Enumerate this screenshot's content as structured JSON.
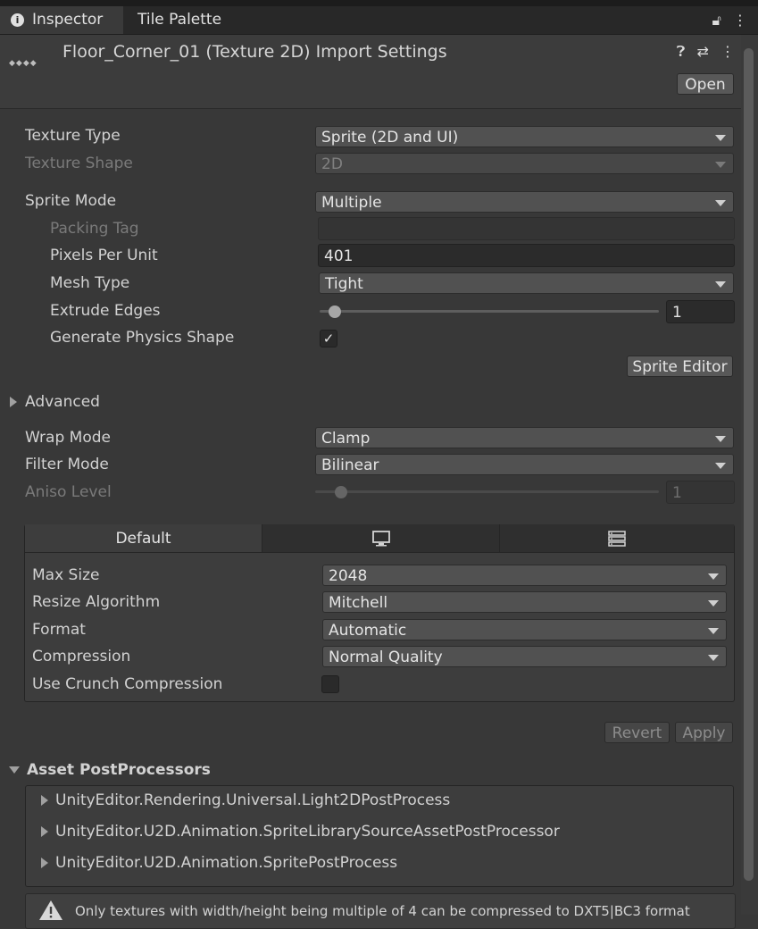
{
  "tabs": [
    {
      "label": "Inspector",
      "icon": "info-icon"
    },
    {
      "label": "Tile Palette"
    }
  ],
  "header": {
    "title": "Floor_Corner_01 (Texture 2D) Import Settings",
    "open_label": "Open",
    "tool_icons": [
      "help-icon",
      "preset-icon",
      "more-icon"
    ]
  },
  "settings": {
    "texture_type": {
      "label": "Texture Type",
      "value": "Sprite (2D and UI)"
    },
    "texture_shape": {
      "label": "Texture Shape",
      "value": "2D"
    },
    "sprite_mode": {
      "label": "Sprite Mode",
      "value": "Multiple"
    },
    "packing_tag": {
      "label": "Packing Tag",
      "value": ""
    },
    "pixels_per_unit": {
      "label": "Pixels Per Unit",
      "value": "401"
    },
    "mesh_type": {
      "label": "Mesh Type",
      "value": "Tight"
    },
    "extrude_edges": {
      "label": "Extrude Edges",
      "value": "1"
    },
    "generate_physics_shape": {
      "label": "Generate Physics Shape",
      "checked": true,
      "check_glyph": "✓"
    },
    "sprite_editor_label": "Sprite Editor",
    "advanced_label": "Advanced",
    "wrap_mode": {
      "label": "Wrap Mode",
      "value": "Clamp"
    },
    "filter_mode": {
      "label": "Filter Mode",
      "value": "Bilinear"
    },
    "aniso_level": {
      "label": "Aniso Level",
      "value": "1"
    }
  },
  "platform": {
    "tabs": [
      {
        "label": "Default"
      },
      {
        "icon": "monitor-icon"
      },
      {
        "icon": "server-icon"
      }
    ],
    "max_size": {
      "label": "Max Size",
      "value": "2048"
    },
    "resize_algorithm": {
      "label": "Resize Algorithm",
      "value": "Mitchell"
    },
    "format": {
      "label": "Format",
      "value": "Automatic"
    },
    "compression": {
      "label": "Compression",
      "value": "Normal Quality"
    },
    "use_crunch": {
      "label": "Use Crunch Compression",
      "checked": false
    }
  },
  "actions": {
    "revert": "Revert",
    "apply": "Apply"
  },
  "postprocessors": {
    "title": "Asset PostProcessors",
    "items": [
      "UnityEditor.Rendering.Universal.Light2DPostProcess",
      "UnityEditor.U2D.Animation.SpriteLibrarySourceAssetPostProcessor",
      "UnityEditor.U2D.Animation.SpritePostProcess"
    ]
  },
  "warning": {
    "text": "Only textures with width/height being multiple of 4 can be compressed to DXT5|BC3 format"
  }
}
